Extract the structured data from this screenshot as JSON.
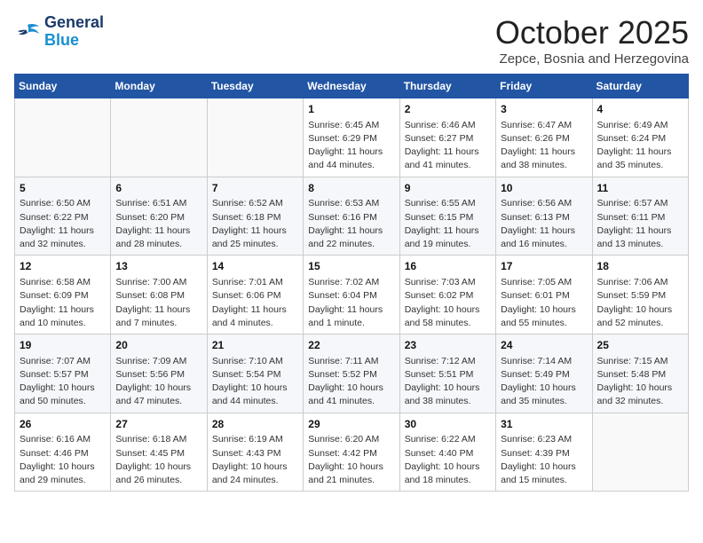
{
  "header": {
    "logo_line1": "General",
    "logo_line2": "Blue",
    "month": "October 2025",
    "location": "Zepce, Bosnia and Herzegovina"
  },
  "days_of_week": [
    "Sunday",
    "Monday",
    "Tuesday",
    "Wednesday",
    "Thursday",
    "Friday",
    "Saturday"
  ],
  "weeks": [
    [
      {
        "day": "",
        "info": ""
      },
      {
        "day": "",
        "info": ""
      },
      {
        "day": "",
        "info": ""
      },
      {
        "day": "1",
        "info": "Sunrise: 6:45 AM\nSunset: 6:29 PM\nDaylight: 11 hours\nand 44 minutes."
      },
      {
        "day": "2",
        "info": "Sunrise: 6:46 AM\nSunset: 6:27 PM\nDaylight: 11 hours\nand 41 minutes."
      },
      {
        "day": "3",
        "info": "Sunrise: 6:47 AM\nSunset: 6:26 PM\nDaylight: 11 hours\nand 38 minutes."
      },
      {
        "day": "4",
        "info": "Sunrise: 6:49 AM\nSunset: 6:24 PM\nDaylight: 11 hours\nand 35 minutes."
      }
    ],
    [
      {
        "day": "5",
        "info": "Sunrise: 6:50 AM\nSunset: 6:22 PM\nDaylight: 11 hours\nand 32 minutes."
      },
      {
        "day": "6",
        "info": "Sunrise: 6:51 AM\nSunset: 6:20 PM\nDaylight: 11 hours\nand 28 minutes."
      },
      {
        "day": "7",
        "info": "Sunrise: 6:52 AM\nSunset: 6:18 PM\nDaylight: 11 hours\nand 25 minutes."
      },
      {
        "day": "8",
        "info": "Sunrise: 6:53 AM\nSunset: 6:16 PM\nDaylight: 11 hours\nand 22 minutes."
      },
      {
        "day": "9",
        "info": "Sunrise: 6:55 AM\nSunset: 6:15 PM\nDaylight: 11 hours\nand 19 minutes."
      },
      {
        "day": "10",
        "info": "Sunrise: 6:56 AM\nSunset: 6:13 PM\nDaylight: 11 hours\nand 16 minutes."
      },
      {
        "day": "11",
        "info": "Sunrise: 6:57 AM\nSunset: 6:11 PM\nDaylight: 11 hours\nand 13 minutes."
      }
    ],
    [
      {
        "day": "12",
        "info": "Sunrise: 6:58 AM\nSunset: 6:09 PM\nDaylight: 11 hours\nand 10 minutes."
      },
      {
        "day": "13",
        "info": "Sunrise: 7:00 AM\nSunset: 6:08 PM\nDaylight: 11 hours\nand 7 minutes."
      },
      {
        "day": "14",
        "info": "Sunrise: 7:01 AM\nSunset: 6:06 PM\nDaylight: 11 hours\nand 4 minutes."
      },
      {
        "day": "15",
        "info": "Sunrise: 7:02 AM\nSunset: 6:04 PM\nDaylight: 11 hours\nand 1 minute."
      },
      {
        "day": "16",
        "info": "Sunrise: 7:03 AM\nSunset: 6:02 PM\nDaylight: 10 hours\nand 58 minutes."
      },
      {
        "day": "17",
        "info": "Sunrise: 7:05 AM\nSunset: 6:01 PM\nDaylight: 10 hours\nand 55 minutes."
      },
      {
        "day": "18",
        "info": "Sunrise: 7:06 AM\nSunset: 5:59 PM\nDaylight: 10 hours\nand 52 minutes."
      }
    ],
    [
      {
        "day": "19",
        "info": "Sunrise: 7:07 AM\nSunset: 5:57 PM\nDaylight: 10 hours\nand 50 minutes."
      },
      {
        "day": "20",
        "info": "Sunrise: 7:09 AM\nSunset: 5:56 PM\nDaylight: 10 hours\nand 47 minutes."
      },
      {
        "day": "21",
        "info": "Sunrise: 7:10 AM\nSunset: 5:54 PM\nDaylight: 10 hours\nand 44 minutes."
      },
      {
        "day": "22",
        "info": "Sunrise: 7:11 AM\nSunset: 5:52 PM\nDaylight: 10 hours\nand 41 minutes."
      },
      {
        "day": "23",
        "info": "Sunrise: 7:12 AM\nSunset: 5:51 PM\nDaylight: 10 hours\nand 38 minutes."
      },
      {
        "day": "24",
        "info": "Sunrise: 7:14 AM\nSunset: 5:49 PM\nDaylight: 10 hours\nand 35 minutes."
      },
      {
        "day": "25",
        "info": "Sunrise: 7:15 AM\nSunset: 5:48 PM\nDaylight: 10 hours\nand 32 minutes."
      }
    ],
    [
      {
        "day": "26",
        "info": "Sunrise: 6:16 AM\nSunset: 4:46 PM\nDaylight: 10 hours\nand 29 minutes."
      },
      {
        "day": "27",
        "info": "Sunrise: 6:18 AM\nSunset: 4:45 PM\nDaylight: 10 hours\nand 26 minutes."
      },
      {
        "day": "28",
        "info": "Sunrise: 6:19 AM\nSunset: 4:43 PM\nDaylight: 10 hours\nand 24 minutes."
      },
      {
        "day": "29",
        "info": "Sunrise: 6:20 AM\nSunset: 4:42 PM\nDaylight: 10 hours\nand 21 minutes."
      },
      {
        "day": "30",
        "info": "Sunrise: 6:22 AM\nSunset: 4:40 PM\nDaylight: 10 hours\nand 18 minutes."
      },
      {
        "day": "31",
        "info": "Sunrise: 6:23 AM\nSunset: 4:39 PM\nDaylight: 10 hours\nand 15 minutes."
      },
      {
        "day": "",
        "info": ""
      }
    ]
  ]
}
